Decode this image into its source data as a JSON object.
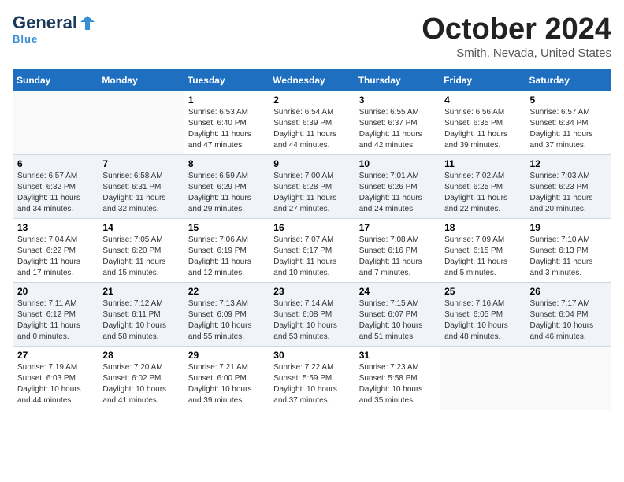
{
  "logo": {
    "line1a": "General",
    "line1b": "Blue",
    "underline": "Blue"
  },
  "title": {
    "month": "October 2024",
    "location": "Smith, Nevada, United States"
  },
  "weekdays": [
    "Sunday",
    "Monday",
    "Tuesday",
    "Wednesday",
    "Thursday",
    "Friday",
    "Saturday"
  ],
  "weeks": [
    [
      {
        "day": "",
        "info": ""
      },
      {
        "day": "",
        "info": ""
      },
      {
        "day": "1",
        "sunrise": "6:53 AM",
        "sunset": "6:40 PM",
        "daylight": "11 hours and 47 minutes."
      },
      {
        "day": "2",
        "sunrise": "6:54 AM",
        "sunset": "6:39 PM",
        "daylight": "11 hours and 44 minutes."
      },
      {
        "day": "3",
        "sunrise": "6:55 AM",
        "sunset": "6:37 PM",
        "daylight": "11 hours and 42 minutes."
      },
      {
        "day": "4",
        "sunrise": "6:56 AM",
        "sunset": "6:35 PM",
        "daylight": "11 hours and 39 minutes."
      },
      {
        "day": "5",
        "sunrise": "6:57 AM",
        "sunset": "6:34 PM",
        "daylight": "11 hours and 37 minutes."
      }
    ],
    [
      {
        "day": "6",
        "sunrise": "6:57 AM",
        "sunset": "6:32 PM",
        "daylight": "11 hours and 34 minutes."
      },
      {
        "day": "7",
        "sunrise": "6:58 AM",
        "sunset": "6:31 PM",
        "daylight": "11 hours and 32 minutes."
      },
      {
        "day": "8",
        "sunrise": "6:59 AM",
        "sunset": "6:29 PM",
        "daylight": "11 hours and 29 minutes."
      },
      {
        "day": "9",
        "sunrise": "7:00 AM",
        "sunset": "6:28 PM",
        "daylight": "11 hours and 27 minutes."
      },
      {
        "day": "10",
        "sunrise": "7:01 AM",
        "sunset": "6:26 PM",
        "daylight": "11 hours and 24 minutes."
      },
      {
        "day": "11",
        "sunrise": "7:02 AM",
        "sunset": "6:25 PM",
        "daylight": "11 hours and 22 minutes."
      },
      {
        "day": "12",
        "sunrise": "7:03 AM",
        "sunset": "6:23 PM",
        "daylight": "11 hours and 20 minutes."
      }
    ],
    [
      {
        "day": "13",
        "sunrise": "7:04 AM",
        "sunset": "6:22 PM",
        "daylight": "11 hours and 17 minutes."
      },
      {
        "day": "14",
        "sunrise": "7:05 AM",
        "sunset": "6:20 PM",
        "daylight": "11 hours and 15 minutes."
      },
      {
        "day": "15",
        "sunrise": "7:06 AM",
        "sunset": "6:19 PM",
        "daylight": "11 hours and 12 minutes."
      },
      {
        "day": "16",
        "sunrise": "7:07 AM",
        "sunset": "6:17 PM",
        "daylight": "11 hours and 10 minutes."
      },
      {
        "day": "17",
        "sunrise": "7:08 AM",
        "sunset": "6:16 PM",
        "daylight": "11 hours and 7 minutes."
      },
      {
        "day": "18",
        "sunrise": "7:09 AM",
        "sunset": "6:15 PM",
        "daylight": "11 hours and 5 minutes."
      },
      {
        "day": "19",
        "sunrise": "7:10 AM",
        "sunset": "6:13 PM",
        "daylight": "11 hours and 3 minutes."
      }
    ],
    [
      {
        "day": "20",
        "sunrise": "7:11 AM",
        "sunset": "6:12 PM",
        "daylight": "11 hours and 0 minutes."
      },
      {
        "day": "21",
        "sunrise": "7:12 AM",
        "sunset": "6:11 PM",
        "daylight": "10 hours and 58 minutes."
      },
      {
        "day": "22",
        "sunrise": "7:13 AM",
        "sunset": "6:09 PM",
        "daylight": "10 hours and 55 minutes."
      },
      {
        "day": "23",
        "sunrise": "7:14 AM",
        "sunset": "6:08 PM",
        "daylight": "10 hours and 53 minutes."
      },
      {
        "day": "24",
        "sunrise": "7:15 AM",
        "sunset": "6:07 PM",
        "daylight": "10 hours and 51 minutes."
      },
      {
        "day": "25",
        "sunrise": "7:16 AM",
        "sunset": "6:05 PM",
        "daylight": "10 hours and 48 minutes."
      },
      {
        "day": "26",
        "sunrise": "7:17 AM",
        "sunset": "6:04 PM",
        "daylight": "10 hours and 46 minutes."
      }
    ],
    [
      {
        "day": "27",
        "sunrise": "7:19 AM",
        "sunset": "6:03 PM",
        "daylight": "10 hours and 44 minutes."
      },
      {
        "day": "28",
        "sunrise": "7:20 AM",
        "sunset": "6:02 PM",
        "daylight": "10 hours and 41 minutes."
      },
      {
        "day": "29",
        "sunrise": "7:21 AM",
        "sunset": "6:00 PM",
        "daylight": "10 hours and 39 minutes."
      },
      {
        "day": "30",
        "sunrise": "7:22 AM",
        "sunset": "5:59 PM",
        "daylight": "10 hours and 37 minutes."
      },
      {
        "day": "31",
        "sunrise": "7:23 AM",
        "sunset": "5:58 PM",
        "daylight": "10 hours and 35 minutes."
      },
      {
        "day": "",
        "info": ""
      },
      {
        "day": "",
        "info": ""
      }
    ]
  ]
}
